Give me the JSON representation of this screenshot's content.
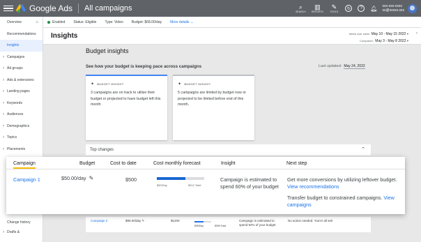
{
  "topbar": {
    "logo": "Google Ads",
    "page_title": "All campaigns",
    "icons": [
      {
        "name": "search-icon",
        "glyph": "⌕",
        "label": "SEARCH"
      },
      {
        "name": "reports-icon",
        "glyph": "▥",
        "label": "REPORTS"
      },
      {
        "name": "tools-icon",
        "glyph": "✎",
        "label": "TOOLS"
      }
    ],
    "account_line1": "xxx-xxx-xxxx",
    "account_line2": "xx@xxxxx.xxx"
  },
  "sidebar": {
    "items": [
      {
        "label": "Overview",
        "arrow": false
      },
      {
        "label": "Recommendations",
        "arrow": false
      },
      {
        "label": "Insights",
        "arrow": false,
        "active": true
      },
      {
        "label": "Campaigns",
        "arrow": true
      },
      {
        "label": "Ad groups",
        "arrow": true
      },
      {
        "label": "Ads & extensions",
        "arrow": true
      },
      {
        "label": "Landing pages",
        "arrow": true
      },
      {
        "label": "Keywords",
        "arrow": true
      },
      {
        "label": "Audiences",
        "arrow": true
      },
      {
        "label": "Demographics",
        "arrow": true
      },
      {
        "label": "Topics",
        "arrow": true
      },
      {
        "label": "Placements",
        "arrow": true
      }
    ],
    "bottom_items": [
      "Change history",
      "Drafts &"
    ]
  },
  "status": {
    "enabled": "Enabled",
    "status": "Status: Eligible",
    "type": "Type: Video",
    "budget": "Budget: $68.00/day",
    "more": "More details"
  },
  "header": {
    "title": "Insights",
    "wow_label": "Week over week",
    "date_current": "May 10 - May 15 2022",
    "compared_label": "Compared:",
    "date_compared": "May 3 - May 8 2022"
  },
  "main": {
    "title": "Budget insights",
    "subtitle": "See how your budget is keeping pace across campaigns",
    "last_updated_label": "Last updated:",
    "last_updated_value": "May 24, 2022",
    "cards": [
      {
        "tag": "BUDGET INSIGHT",
        "text": "3 campaigns are on track to utilize their budget or projected to have budget left this month"
      },
      {
        "tag": "BUDGET INSIGHT",
        "text": "5 campaigns are limited by budget now or projected to be limited before end of this month."
      }
    ],
    "top_changes": "Top changes"
  },
  "overlay": {
    "headers": [
      "Campaign",
      "Budget",
      "Cost to date",
      "Cost monthly forecast",
      "Insight",
      "Next step"
    ],
    "row": {
      "campaign": "Campaign 1",
      "budget": "$50.00/day",
      "cost_to_date": "$500",
      "bar_left_label": "$50/Day",
      "bar_right_label": "$912 Total",
      "bar_fraction": 0.6,
      "insight": "Campaign is estimated to spend 60% of your budget",
      "next_step_1": "Get more conversions by utilizing leftover budget.",
      "next_step_1_link": "View recommendations",
      "next_step_2": "Transfer budget to constrained campaigns.",
      "next_step_2_link": "View campaigns"
    }
  },
  "bottom_row": {
    "campaign": "Campaign 2",
    "budget": "$95.00/day",
    "cost": "$1200",
    "bar_left": "$95/Day",
    "bar_right": "$999 Total",
    "insight": "Campaign is estimated to spend 92% of your budget",
    "next_step": "No action needed. You're all set!"
  }
}
